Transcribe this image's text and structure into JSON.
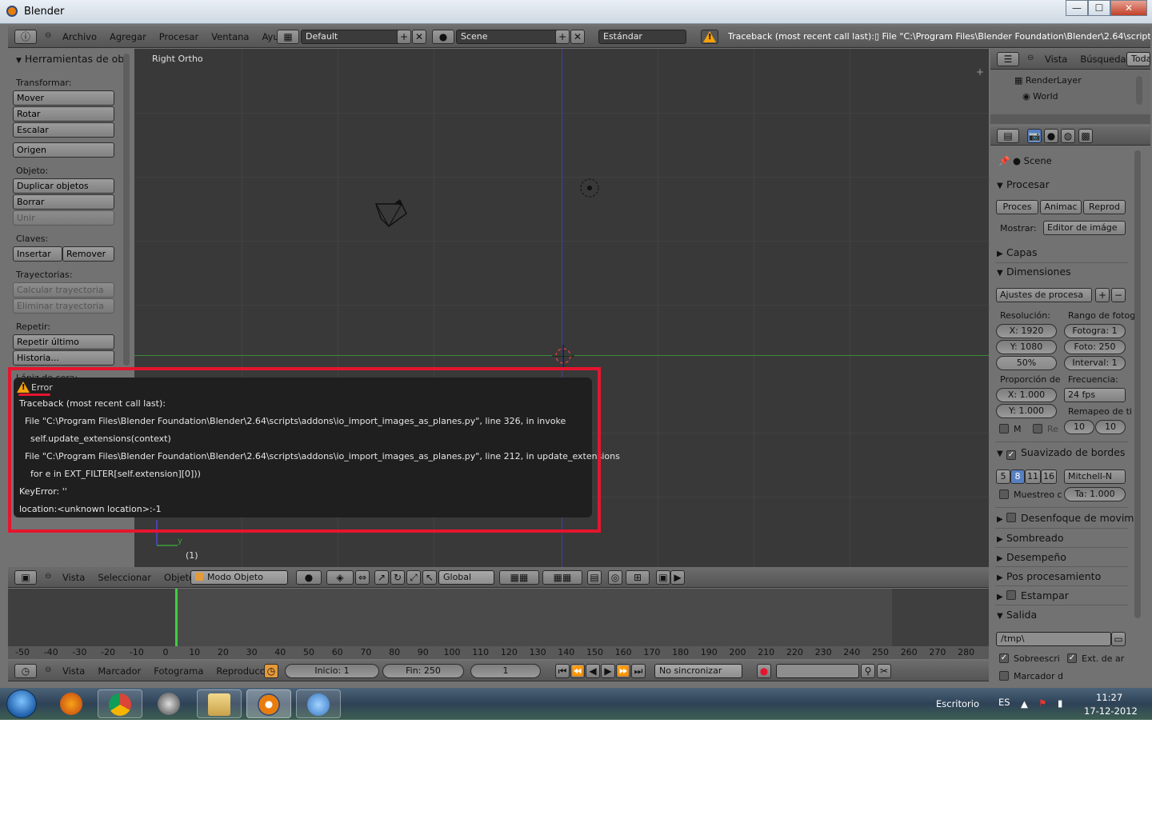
{
  "window": {
    "title": "Blender",
    "min": "—",
    "max": "☐",
    "close": "✕"
  },
  "topbar": {
    "menu": [
      "Archivo",
      "Agregar",
      "Procesar",
      "Ventana",
      "Ayuda"
    ],
    "layout": "Default",
    "scene": "Scene",
    "engine": "Estándar",
    "report": "Traceback (most recent call last):▯  File \"C:\\Program Files\\Blender Foundation\\Blender\\2.64\\scripts\\addon"
  },
  "toolshelf": {
    "header": "Herramientas de obj",
    "transform_label": "Transformar:",
    "move": "Mover",
    "rotate": "Rotar",
    "scale": "Escalar",
    "origin": "Origen",
    "object_label": "Objeto:",
    "duplicate": "Duplicar objetos",
    "delete": "Borrar",
    "join": "Unir",
    "keys_label": "Claves:",
    "insert": "Insertar",
    "remove": "Remover",
    "paths_label": "Trayectorias:",
    "calc_path": "Calcular trayectoria",
    "clear_path": "Eliminar trayectoria",
    "repeat_label": "Repetir:",
    "repeat_last": "Repetir último",
    "history": "Historia...",
    "grease_label": "Lápiz de cera:"
  },
  "viewport": {
    "title": "Right Ortho",
    "frame": "(1)",
    "axis_y": "y"
  },
  "error_popup": {
    "title": "Error",
    "lines": [
      "Traceback (most recent call last):",
      "  File \"C:\\Program Files\\Blender Foundation\\Blender\\2.64\\scripts\\addons\\io_import_images_as_planes.py\", line 326, in invoke",
      "    self.update_extensions(context)",
      "  File \"C:\\Program Files\\Blender Foundation\\Blender\\2.64\\scripts\\addons\\io_import_images_as_planes.py\", line 212, in update_extensions",
      "    for e in EXT_FILTER[self.extension][0]))",
      "KeyError: ''",
      "location:<unknown location>:-1"
    ]
  },
  "view3d_header": {
    "menu": [
      "Vista",
      "Seleccionar",
      "Objeto"
    ],
    "mode": "Modo Objeto",
    "orientation": "Global"
  },
  "outliner": {
    "menu": [
      "Vista",
      "Búsqueda"
    ],
    "filter": "Toda",
    "items": [
      "RenderLayer",
      "World"
    ]
  },
  "properties": {
    "scene": "Scene",
    "render_section": "Procesar",
    "render_btn": "Proces",
    "anim_btn": "Animac",
    "play_btn": "Reprod",
    "display_label": "Mostrar:",
    "display_value": "Editor de imáge",
    "layers": "Capas",
    "dimensions": "Dimensiones",
    "preset": "Ajustes de procesa",
    "resolution_label": "Resolución:",
    "frame_range_label": "Rango de fotog",
    "res_x": "X: 1920",
    "res_y": "Y: 1080",
    "res_pct": "50%",
    "frame_start": "Fotogra: 1",
    "frame_end": "Foto: 250",
    "frame_step": "Interval: 1",
    "aspect_label": "Proporción de",
    "fps_label": "Frecuencia:",
    "aspect_x": "X: 1.000",
    "aspect_y": "Y: 1.000",
    "fps": "24 fps",
    "remap_label": "Remapeo de ti",
    "remap_old": "10",
    "remap_new": "10",
    "border_m": "M",
    "border_re": "Re",
    "aa_section": "Suavizado de bordes",
    "aa_samples": [
      "5",
      "8",
      "11",
      "16"
    ],
    "aa_filter": "Mitchell-N",
    "sampled": "Muestreo c",
    "filter_size": "Ta: 1.000",
    "motion_blur": "Desenfoque de movimi",
    "shading": "Sombreado",
    "performance": "Desempeño",
    "post": "Pos procesamiento",
    "stamp": "Estampar",
    "output": "Salida",
    "output_path": "/tmp\\",
    "overwrite": "Sobreescri",
    "file_ext": "Ext. de ar",
    "placeholders": "Marcador d"
  },
  "timeline": {
    "ruler": [
      "-50",
      "-40",
      "-30",
      "-20",
      "-10",
      "0",
      "10",
      "20",
      "30",
      "40",
      "50",
      "60",
      "70",
      "80",
      "90",
      "100",
      "110",
      "120",
      "130",
      "140",
      "150",
      "160",
      "170",
      "180",
      "190",
      "200",
      "210",
      "220",
      "230",
      "240",
      "250",
      "260",
      "270",
      "280"
    ],
    "menu": [
      "Vista",
      "Marcador",
      "Fotograma",
      "Reproducción"
    ],
    "start": "Inicio: 1",
    "end": "Fin: 250",
    "current": "1",
    "sync": "No sincronizar"
  },
  "taskbar": {
    "desktop": "Escritorio",
    "lang": "ES",
    "time": "11:27",
    "date": "17-12-2012"
  },
  "colors": {
    "accent": "#e5152e",
    "warning": "#f5a20a",
    "active_blue": "#5680c2"
  }
}
